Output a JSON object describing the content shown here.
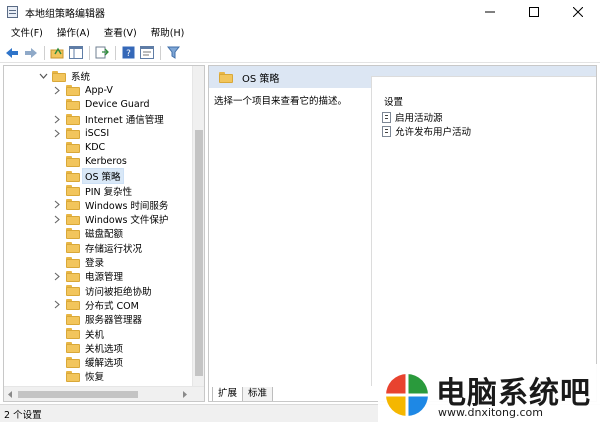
{
  "window": {
    "title": "本地组策略编辑器",
    "minimize_icon": "minimize-icon",
    "maximize_icon": "maximize-icon",
    "close_icon": "close-icon"
  },
  "menu": {
    "items": [
      {
        "label": "文件(F)"
      },
      {
        "label": "操作(A)"
      },
      {
        "label": "查看(V)"
      },
      {
        "label": "帮助(H)"
      }
    ]
  },
  "toolbar": {
    "icons": [
      "back-arrow-icon",
      "forward-arrow-icon",
      "up-folder-icon",
      "show-hide-tree-icon",
      "export-list-icon",
      "help-icon",
      "properties-icon",
      "filter-icon"
    ]
  },
  "tree": {
    "items": [
      {
        "label": "系统",
        "level": 0,
        "expandable": true,
        "expanded": true
      },
      {
        "label": "App-V",
        "level": 1,
        "expandable": true
      },
      {
        "label": "Device Guard",
        "level": 1,
        "expandable": false
      },
      {
        "label": "Internet 通信管理",
        "level": 1,
        "expandable": true
      },
      {
        "label": "iSCSI",
        "level": 1,
        "expandable": true
      },
      {
        "label": "KDC",
        "level": 1,
        "expandable": false
      },
      {
        "label": "Kerberos",
        "level": 1,
        "expandable": false
      },
      {
        "label": "OS 策略",
        "level": 1,
        "expandable": false,
        "selected": true
      },
      {
        "label": "PIN 复杂性",
        "level": 1,
        "expandable": false
      },
      {
        "label": "Windows 时间服务",
        "level": 1,
        "expandable": true
      },
      {
        "label": "Windows 文件保护",
        "level": 1,
        "expandable": true
      },
      {
        "label": "磁盘配额",
        "level": 1,
        "expandable": false
      },
      {
        "label": "存储运行状况",
        "level": 1,
        "expandable": false
      },
      {
        "label": "登录",
        "level": 1,
        "expandable": false
      },
      {
        "label": "电源管理",
        "level": 1,
        "expandable": true
      },
      {
        "label": "访问被拒绝协助",
        "level": 1,
        "expandable": false
      },
      {
        "label": "分布式 COM",
        "level": 1,
        "expandable": true
      },
      {
        "label": "服务器管理器",
        "level": 1,
        "expandable": false
      },
      {
        "label": "关机",
        "level": 1,
        "expandable": false
      },
      {
        "label": "关机选项",
        "level": 1,
        "expandable": false
      },
      {
        "label": "缓解选项",
        "level": 1,
        "expandable": false
      },
      {
        "label": "恢复",
        "level": 1,
        "expandable": false
      }
    ]
  },
  "detail": {
    "title": "OS 策略",
    "description": "选择一个项目来查看它的描述。",
    "settings_header": "设置",
    "settings": [
      {
        "label": "启用活动源"
      },
      {
        "label": "允许发布用户活动"
      }
    ],
    "tabs": [
      {
        "label": "扩展",
        "active": true
      },
      {
        "label": "标准",
        "active": false
      }
    ]
  },
  "status": {
    "text": "2 个设置"
  },
  "watermark": {
    "title": "电脑系统吧",
    "url": "www.dnxitong.com",
    "colors": [
      "#e8432f",
      "#2a9a3c",
      "#f5b700",
      "#1e88e5"
    ]
  }
}
